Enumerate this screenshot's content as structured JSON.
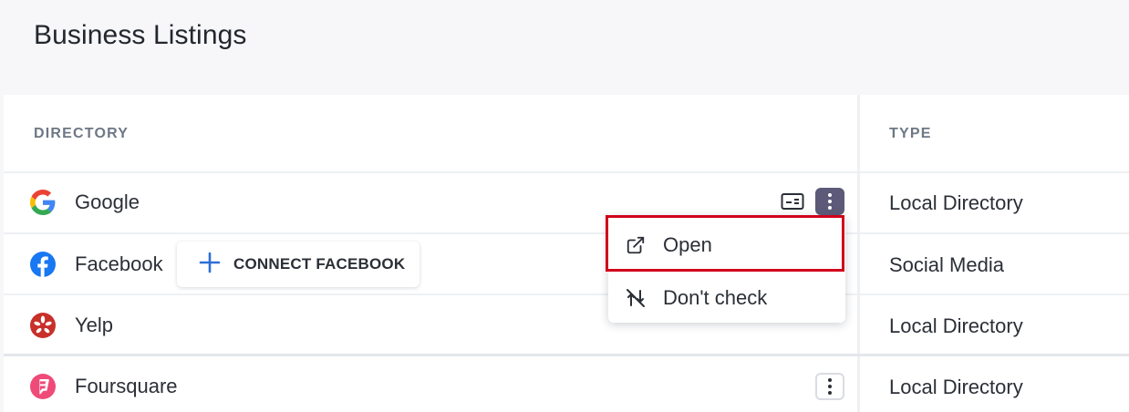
{
  "page": {
    "title": "Business Listings"
  },
  "table": {
    "headers": {
      "directory": "DIRECTORY",
      "type": "TYPE"
    },
    "rows": [
      {
        "name": "Google",
        "icon": "google-icon",
        "type": "Local Directory"
      },
      {
        "name": "Facebook",
        "icon": "facebook-icon",
        "type": "Social Media"
      },
      {
        "name": "Yelp",
        "icon": "yelp-icon",
        "type": "Local Directory"
      },
      {
        "name": "Foursquare",
        "icon": "foursquare-icon",
        "type": "Local Directory"
      }
    ]
  },
  "connect_button": {
    "label": "CONNECT FACEBOOK",
    "icon": "plus-icon"
  },
  "context_menu": {
    "items": [
      {
        "label": "Open",
        "icon": "external-link-icon"
      },
      {
        "label": "Don't check",
        "icon": "sync-off-icon"
      }
    ]
  },
  "colors": {
    "accent": "#2f6fd6",
    "highlight": "#d0021b",
    "kebab_active": "#5c5a78"
  }
}
